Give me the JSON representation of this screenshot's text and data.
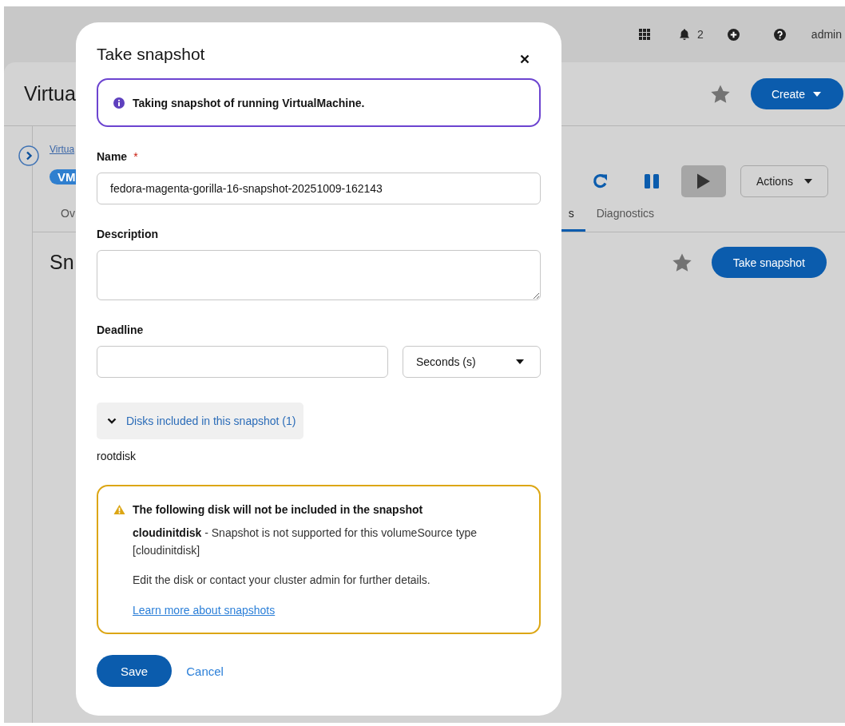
{
  "masthead": {
    "notification_count": "2",
    "user": "admin"
  },
  "page": {
    "title": "Virtua",
    "create_button": "Create",
    "breadcrumb": "Virtua",
    "vm_badge": "VM",
    "actions_button": "Actions",
    "tabs": [
      {
        "label": "Ov",
        "selected": false
      },
      {
        "label": "s",
        "selected": true
      },
      {
        "label": "Diagnostics",
        "selected": false
      }
    ],
    "section_title": "Sn",
    "take_snapshot_button": "Take snapshot"
  },
  "modal": {
    "title": "Take snapshot",
    "info_alert": "Taking snapshot of running VirtualMachine.",
    "name": {
      "label": "Name",
      "required": true,
      "required_mark": "*",
      "value": "fedora-magenta-gorilla-16-snapshot-20251009-162143"
    },
    "description": {
      "label": "Description"
    },
    "deadline": {
      "label": "Deadline",
      "unit": "Seconds (s)"
    },
    "disks_toggle": {
      "label": "Disks included in this snapshot (1)",
      "expanded": true
    },
    "disks": [
      "rootdisk"
    ],
    "warning": {
      "title": "The following disk will not be included in the snapshot",
      "detail": "**cloudinitdisk** - Snapshot is not supported for this volumeSource type [cloudinitdisk]",
      "note": "Edit the disk or contact your cluster admin for further details.",
      "link": "Learn more about snapshots"
    },
    "save_button": "Save",
    "cancel_button": "Cancel"
  }
}
